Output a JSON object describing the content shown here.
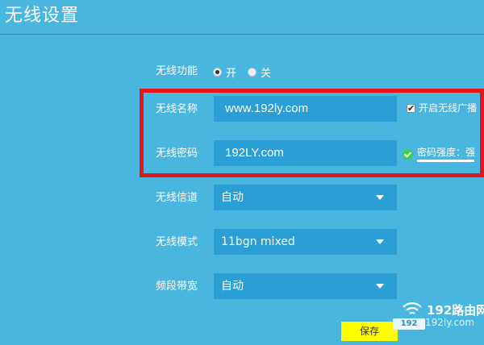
{
  "page": {
    "title": "无线设置"
  },
  "wireless_function": {
    "label": "无线功能",
    "options": [
      "开",
      "关"
    ],
    "selected": "开"
  },
  "ssid": {
    "label": "无线名称",
    "value": "www.192ly.com",
    "broadcast_checked": true,
    "broadcast_label": "开启无线广播"
  },
  "password": {
    "label": "无线密码",
    "value": "192LY.com",
    "strength_text": "密码强度：强",
    "strength_level": 1.0,
    "strength_icon": "check-circle-icon"
  },
  "channel": {
    "label": "无线信道",
    "value": "自动"
  },
  "mode": {
    "label": "无线模式",
    "value": "11bgn mixed"
  },
  "bandwidth": {
    "label": "频段带宽",
    "value": "自动"
  },
  "actions": {
    "save_label": "保存"
  },
  "watermark": {
    "brand": "192路由网",
    "url": "192ly.com",
    "badge": "192"
  },
  "colors": {
    "background": "#49b6df",
    "field": "#2a9fd6",
    "highlight_frame": "#e8141c",
    "save_button": "#ffff00",
    "strength_ok": "#3ecf4a"
  }
}
